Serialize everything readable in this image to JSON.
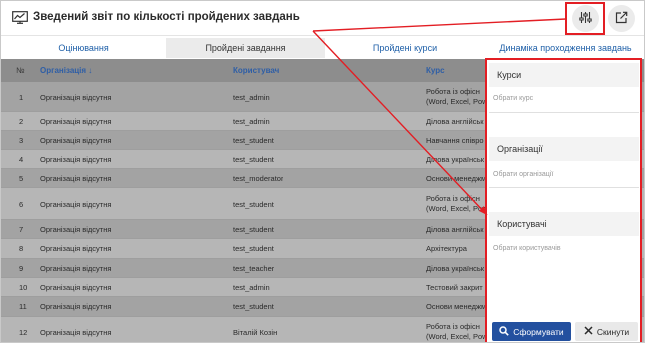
{
  "header": {
    "title": "Зведений звіт по кількості пройдених завдань"
  },
  "tabs": [
    {
      "label": "Оцінювання"
    },
    {
      "label": "Пройдені завдання"
    },
    {
      "label": "Пройдені курси"
    },
    {
      "label": "Динаміка проходження завдань"
    }
  ],
  "table": {
    "columns": {
      "num": "№",
      "org": "Організація ↓",
      "user": "Користувач",
      "course": "Курс"
    },
    "rows": [
      {
        "num": "1",
        "org": "Організація відсутня",
        "user": "test_admin",
        "course_l1": "Робота із офісн",
        "course_l2": "(Word, Excel, Pow"
      },
      {
        "num": "2",
        "org": "Організація відсутня",
        "user": "test_admin",
        "course_l1": "Ділова англійськ",
        "course_l2": ""
      },
      {
        "num": "3",
        "org": "Організація відсутня",
        "user": "test_student",
        "course_l1": "Навчання співро",
        "course_l2": ""
      },
      {
        "num": "4",
        "org": "Організація відсутня",
        "user": "test_student",
        "course_l1": "Ділова українськ",
        "course_l2": ""
      },
      {
        "num": "5",
        "org": "Організація відсутня",
        "user": "test_moderator",
        "course_l1": "Основи менеджм",
        "course_l2": ""
      },
      {
        "num": "6",
        "org": "Організація відсутня",
        "user": "test_student",
        "course_l1": "Робота із офісн",
        "course_l2": "(Word, Excel, Pow"
      },
      {
        "num": "7",
        "org": "Організація відсутня",
        "user": "test_student",
        "course_l1": "Ділова англійськ",
        "course_l2": ""
      },
      {
        "num": "8",
        "org": "Організація відсутня",
        "user": "test_student",
        "course_l1": "Архітектура",
        "course_l2": ""
      },
      {
        "num": "9",
        "org": "Організація відсутня",
        "user": "test_teacher",
        "course_l1": "Ділова українськ",
        "course_l2": ""
      },
      {
        "num": "10",
        "org": "Організація відсутня",
        "user": "test_admin",
        "course_l1": "Тестовий закрит",
        "course_l2": ""
      },
      {
        "num": "11",
        "org": "Організація відсутня",
        "user": "test_student",
        "course_l1": "Основи менеджм",
        "course_l2": ""
      },
      {
        "num": "12",
        "org": "Організація відсутня",
        "user": "Віталій Козін",
        "course_l1": "Робота із офісн",
        "course_l2": "(Word, Excel, Pow"
      }
    ]
  },
  "filters": {
    "courses": {
      "title": "Курси",
      "placeholder": "Обрати курс"
    },
    "organizations": {
      "title": "Організації",
      "placeholder": "Обрати організації"
    },
    "users": {
      "title": "Користувачі",
      "placeholder": "Обрати користувачів"
    },
    "apply_label": "Сформувати",
    "reset_label": "Скинути"
  },
  "colors": {
    "highlight": "#e31e24",
    "primary": "#23509f",
    "link": "#1e5fa8"
  },
  "icons": [
    "report-chart-icon",
    "filter-sliders-icon",
    "external-link-icon",
    "search-icon",
    "close-icon"
  ]
}
